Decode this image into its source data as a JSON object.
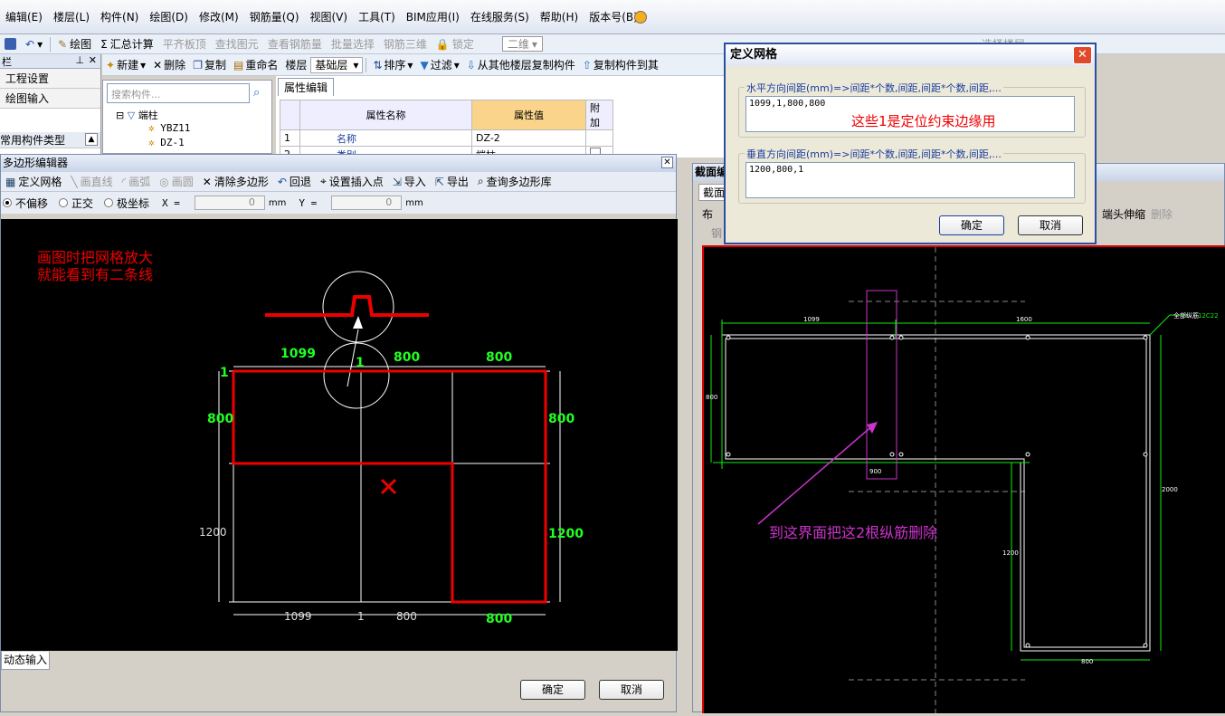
{
  "menu": [
    "编辑(E)",
    "楼层(L)",
    "构件(N)",
    "绘图(D)",
    "修改(M)",
    "钢筋量(Q)",
    "视图(V)",
    "工具(T)",
    "BIM应用(I)",
    "在线服务(S)",
    "帮助(H)",
    "版本号(B)"
  ],
  "toolbar1": {
    "draw": "绘图",
    "sum": "汇总计算",
    "flat": "平齐板顶",
    "find": "查找图元",
    "view_rebar": "查看钢筋量",
    "batch": "批量选择",
    "rebar3d": "钢筋三维",
    "lock": "锁定",
    "mode": "二维",
    "select_floor": "选择楼层"
  },
  "left_panel": {
    "tab_label": "栏",
    "items": [
      "工程设置",
      "绘图输入"
    ],
    "type_label": "常用构件类型"
  },
  "toolbar2": {
    "new": "新建",
    "delete": "删除",
    "copy": "复制",
    "rename": "重命名",
    "floor": "楼层",
    "floor_value": "基础层",
    "sort": "排序",
    "filter": "过滤",
    "copy_from": "从其他楼层复制构件",
    "copy_to": "复制构件到其"
  },
  "tree": {
    "search_placeholder": "搜索构件...",
    "root": "端柱",
    "children": [
      "YBZ11",
      "DZ-1"
    ]
  },
  "props": {
    "tab": "属性编辑",
    "headers": [
      "属性名称",
      "属性值",
      "附加"
    ],
    "rows": [
      {
        "n": "1",
        "name": "名称",
        "value": "DZ-2"
      },
      {
        "n": "2",
        "name": "类别",
        "value": "端柱"
      }
    ]
  },
  "poly": {
    "title": "多边形编辑器",
    "tools": {
      "grid": "定义网格",
      "line": "画直线",
      "arc": "画弧",
      "circle": "画圆",
      "clear": "清除多边形",
      "undo": "回退",
      "insert": "设置插入点",
      "import": "导入",
      "export": "导出",
      "query": "查询多边形库"
    },
    "coord": {
      "no_offset": "不偏移",
      "ortho": "正交",
      "polar": "极坐标",
      "x_label": "X =",
      "y_label": "Y =",
      "x": "0",
      "y": "0",
      "unit": "mm"
    },
    "annotation": [
      "画图时把网格放大",
      "就能看到有二条线"
    ],
    "dims": {
      "top": [
        "1099",
        "1",
        "800",
        "800"
      ],
      "bottom": [
        "1099",
        "1",
        "800",
        "800"
      ],
      "left": [
        "1",
        "800",
        "1200"
      ],
      "right": [
        "800",
        "1200"
      ]
    },
    "dynamic_input": "动态输入",
    "ok": "确定",
    "cancel": "取消"
  },
  "right": {
    "title": "截面编",
    "tab": "截面",
    "btn_layout": "布",
    "btn_rebar": "钢",
    "btn_extend": "端头伸缩",
    "btn_delete": "删除",
    "annotation": "到这界面把这2根纵筋删除",
    "dims": {
      "top_left": "1099",
      "top_mid": "1600",
      "left": "800",
      "right": "2000",
      "mid_left": "1200",
      "bottom": "800",
      "pink": "900",
      "corner_label": "全部纵筋",
      "corner_value": "12C22"
    }
  },
  "dialog": {
    "title": "定义网格",
    "h_label": "水平方向间距(mm)=>间距*个数,间距,间距*个数,间距,...",
    "h_value": "1099,1,800,800",
    "note": "这些1是定位约束边缘用",
    "v_label": "垂直方向间距(mm)=>间距*个数,间距,间距*个数,间距,...",
    "v_value": "1200,800,1",
    "ok": "确定",
    "cancel": "取消"
  }
}
